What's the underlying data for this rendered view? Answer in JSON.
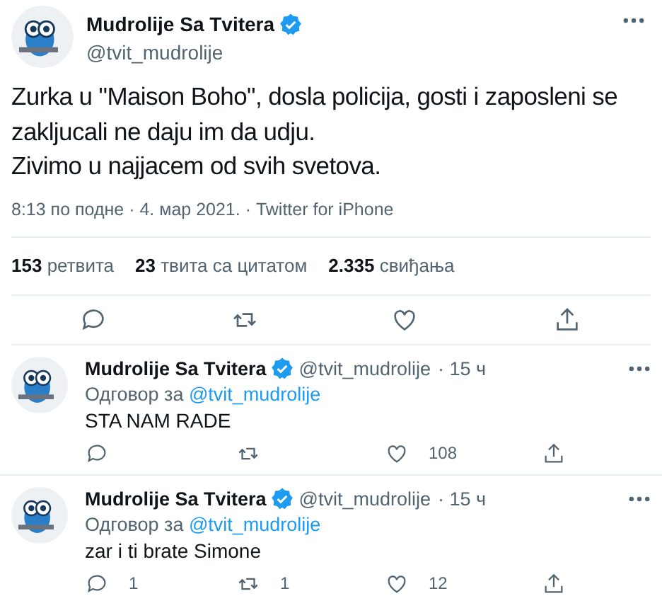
{
  "tweet": {
    "author": {
      "name": "Mudrolije Sa Tvitera",
      "handle": "@tvit_mudrolije",
      "verified": true
    },
    "text_lines": [
      "Zurka u \"Maison Boho\", dosla policija, gosti i zaposleni se zakljucali ne daju im da udju.",
      "Zivimo u najjacem od svih svetova."
    ],
    "meta": "8:13 по подне · 4. мар 2021. · Twitter for iPhone",
    "stats": [
      {
        "count": "153",
        "label": "ретвита"
      },
      {
        "count": "23",
        "label": "твита са цитатом"
      },
      {
        "count": "2.335",
        "label": "свиђања"
      }
    ],
    "actions": [
      {
        "kind": "reply"
      },
      {
        "kind": "retweet"
      },
      {
        "kind": "like"
      },
      {
        "kind": "share"
      }
    ]
  },
  "replies": [
    {
      "name": "Mudrolije Sa Tvitera",
      "verified": true,
      "handle": "@tvit_mudrolije",
      "time": "· 15 ч",
      "reply_label": "Одговор за",
      "reply_to": "@tvit_mudrolije",
      "text": "STA NAM RADE",
      "actions": [
        {
          "kind": "reply"
        },
        {
          "kind": "retweet"
        },
        {
          "kind": "like",
          "count": "108"
        },
        {
          "kind": "share"
        }
      ]
    },
    {
      "name": "Mudrolije Sa Tvitera",
      "verified": true,
      "handle": "@tvit_mudrolije",
      "time": "· 15 ч",
      "reply_label": "Одговор за",
      "reply_to": "@tvit_mudrolije",
      "text": "zar i ti brate Simone",
      "actions": [
        {
          "kind": "reply",
          "count": "1"
        },
        {
          "kind": "retweet",
          "count": "1"
        },
        {
          "kind": "like",
          "count": "12"
        },
        {
          "kind": "share"
        }
      ]
    }
  ]
}
